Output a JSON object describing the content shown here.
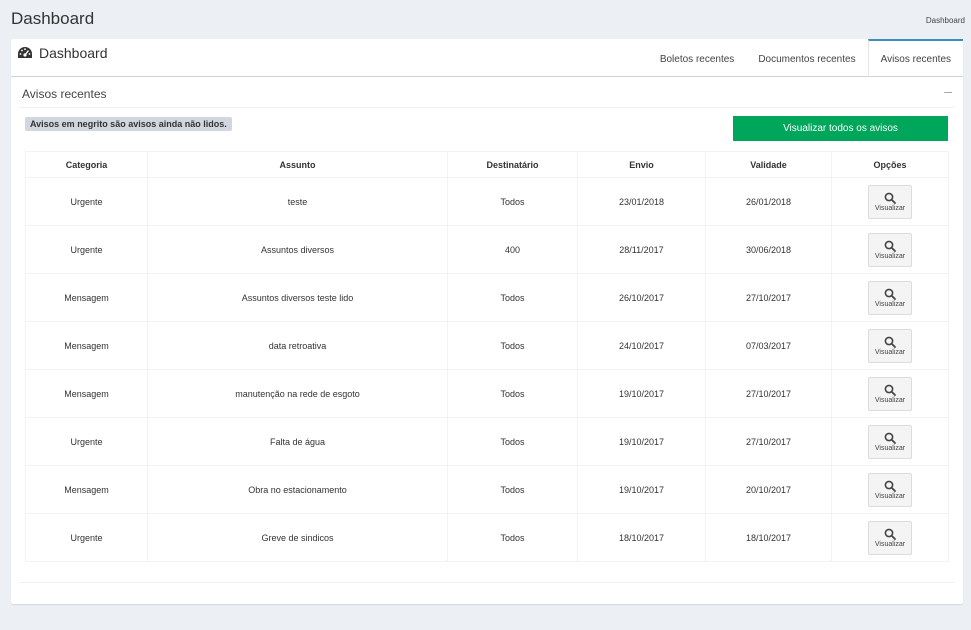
{
  "page": {
    "title": "Dashboard",
    "breadcrumb": "Dashboard"
  },
  "card": {
    "title": "Dashboard",
    "icon": "dashboard-gauge-icon",
    "tabs": [
      {
        "label": "Boletos recentes",
        "active": false
      },
      {
        "label": "Documentos recentes",
        "active": false
      },
      {
        "label": "Avisos recentes",
        "active": true
      }
    ]
  },
  "section": {
    "title": "Avisos recentes",
    "collapse_symbol": "–",
    "notice": "Avisos em negrito são avisos ainda não lidos.",
    "view_all_label": "Visualizar todos os avisos"
  },
  "table": {
    "headers": [
      "Categoria",
      "Assunto",
      "Destinatário",
      "Envio",
      "Validade",
      "Opções"
    ],
    "action_label": "Visualizar",
    "action_icon": "search-icon",
    "rows": [
      {
        "categoria": "Urgente",
        "assunto": "teste",
        "destinatario": "Todos",
        "envio": "23/01/2018",
        "validade": "26/01/2018"
      },
      {
        "categoria": "Urgente",
        "assunto": "Assuntos diversos",
        "destinatario": "400",
        "envio": "28/11/2017",
        "validade": "30/06/2018"
      },
      {
        "categoria": "Mensagem",
        "assunto": "Assuntos diversos teste lido",
        "destinatario": "Todos",
        "envio": "26/10/2017",
        "validade": "27/10/2017"
      },
      {
        "categoria": "Mensagem",
        "assunto": "data retroativa",
        "destinatario": "Todos",
        "envio": "24/10/2017",
        "validade": "07/03/2017"
      },
      {
        "categoria": "Mensagem",
        "assunto": "manutenção na rede de esgoto",
        "destinatario": "Todos",
        "envio": "19/10/2017",
        "validade": "27/10/2017"
      },
      {
        "categoria": "Urgente",
        "assunto": "Falta de água",
        "destinatario": "Todos",
        "envio": "19/10/2017",
        "validade": "27/10/2017"
      },
      {
        "categoria": "Mensagem",
        "assunto": "Obra no estacionamento",
        "destinatario": "Todos",
        "envio": "19/10/2017",
        "validade": "20/10/2017"
      },
      {
        "categoria": "Urgente",
        "assunto": "Greve de sindicos",
        "destinatario": "Todos",
        "envio": "18/10/2017",
        "validade": "18/10/2017"
      }
    ]
  },
  "colors": {
    "accent": "#3c8dbc",
    "success": "#00a65a",
    "background": "#ecf0f5"
  }
}
